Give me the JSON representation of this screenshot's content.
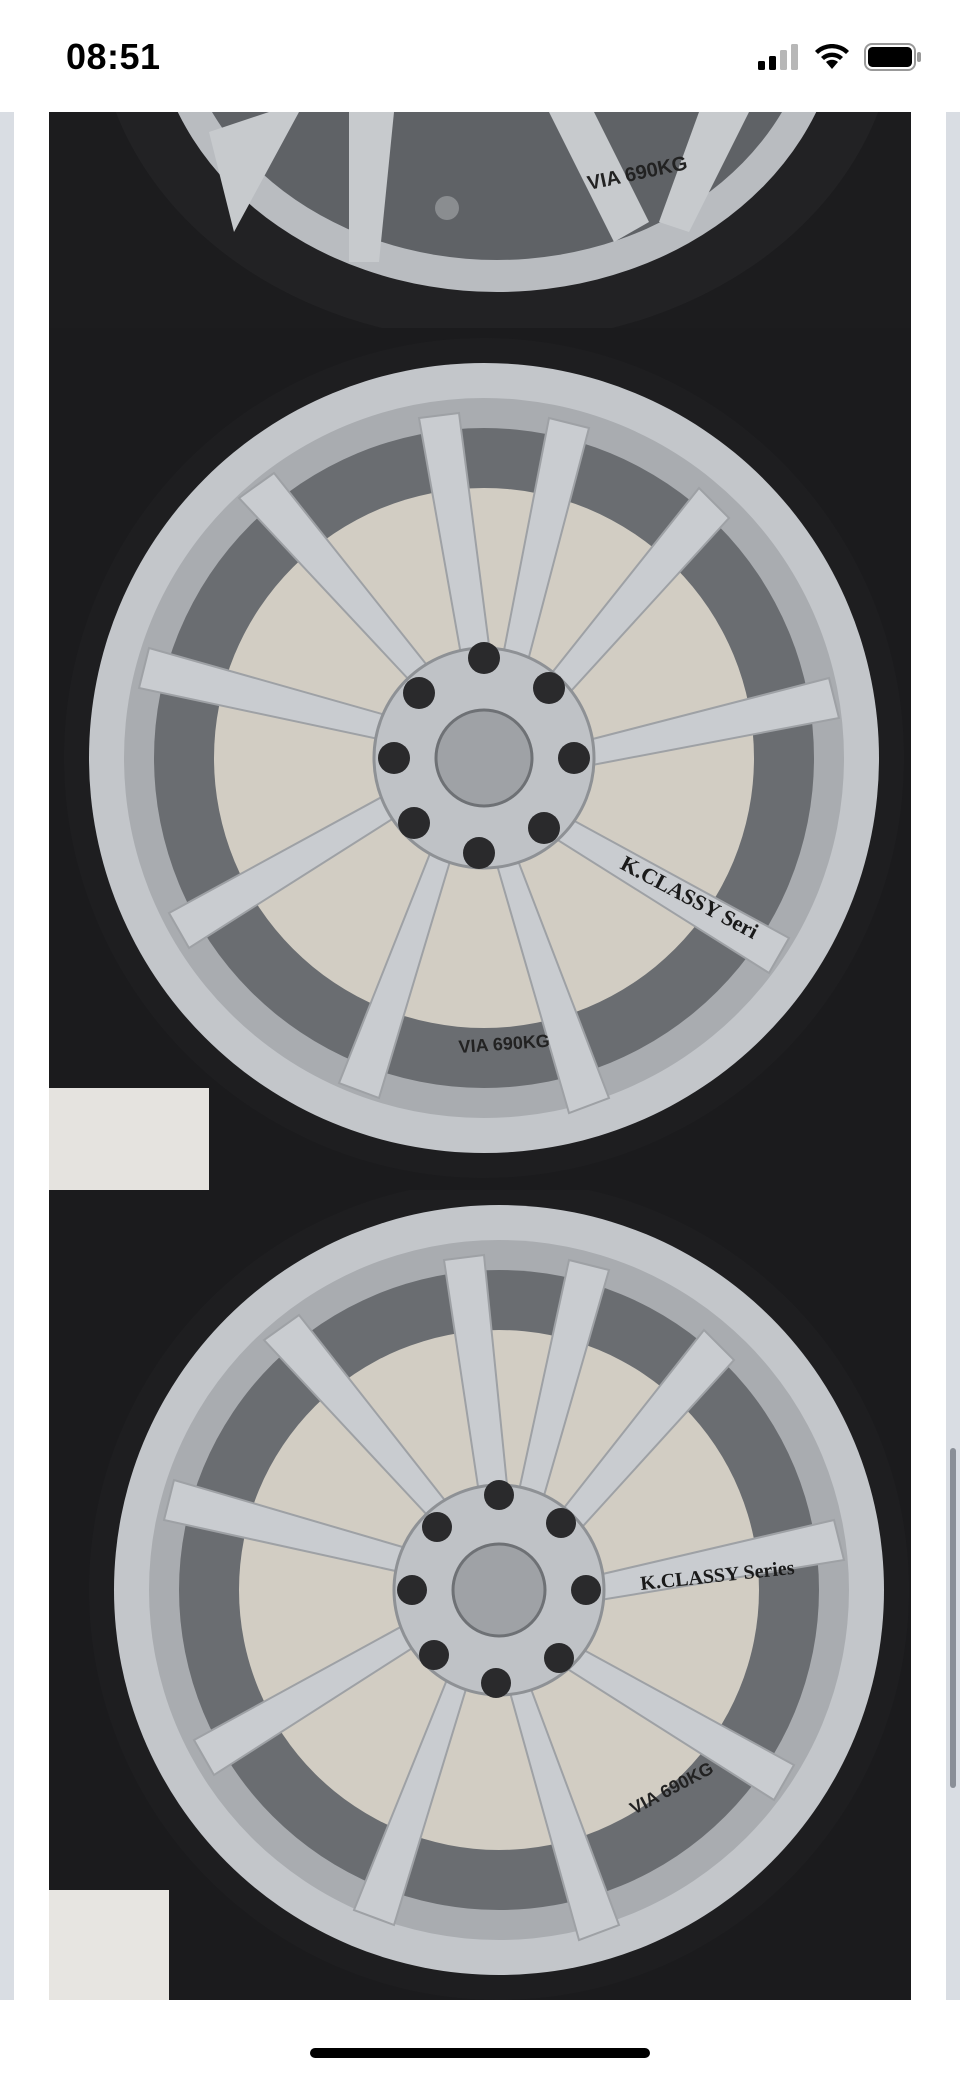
{
  "status_bar": {
    "time": "08:51",
    "icons": [
      "cellular-signal-icon",
      "wifi-icon",
      "battery-icon"
    ]
  },
  "gallery": {
    "photos": [
      {
        "name": "wheel-photo-1",
        "wheel_text": "VIA 690KG"
      },
      {
        "name": "wheel-photo-2",
        "wheel_text": "K.CLASSY Seri",
        "wheel_text_2": "VIA 690KG"
      },
      {
        "name": "wheel-photo-3",
        "wheel_text": "K.CLASSY Series",
        "wheel_text_2": "VIA 690KG"
      }
    ]
  },
  "colors": {
    "rim": "#bfc2c6",
    "tire": "#1b1b1d",
    "background_wall": "#cfcac1"
  }
}
